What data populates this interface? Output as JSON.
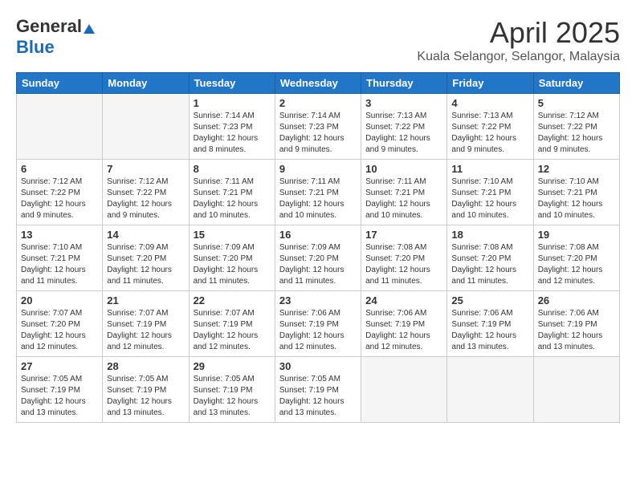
{
  "header": {
    "logo_general": "General",
    "logo_blue": "Blue",
    "title": "April 2025",
    "location": "Kuala Selangor, Selangor, Malaysia"
  },
  "weekdays": [
    "Sunday",
    "Monday",
    "Tuesday",
    "Wednesday",
    "Thursday",
    "Friday",
    "Saturday"
  ],
  "weeks": [
    [
      {
        "day": "",
        "sunrise": "",
        "sunset": "",
        "daylight": ""
      },
      {
        "day": "",
        "sunrise": "",
        "sunset": "",
        "daylight": ""
      },
      {
        "day": "1",
        "sunrise": "7:14 AM",
        "sunset": "7:23 PM",
        "daylight": "12 hours and 8 minutes."
      },
      {
        "day": "2",
        "sunrise": "7:14 AM",
        "sunset": "7:23 PM",
        "daylight": "12 hours and 9 minutes."
      },
      {
        "day": "3",
        "sunrise": "7:13 AM",
        "sunset": "7:22 PM",
        "daylight": "12 hours and 9 minutes."
      },
      {
        "day": "4",
        "sunrise": "7:13 AM",
        "sunset": "7:22 PM",
        "daylight": "12 hours and 9 minutes."
      },
      {
        "day": "5",
        "sunrise": "7:12 AM",
        "sunset": "7:22 PM",
        "daylight": "12 hours and 9 minutes."
      }
    ],
    [
      {
        "day": "6",
        "sunrise": "7:12 AM",
        "sunset": "7:22 PM",
        "daylight": "12 hours and 9 minutes."
      },
      {
        "day": "7",
        "sunrise": "7:12 AM",
        "sunset": "7:22 PM",
        "daylight": "12 hours and 9 minutes."
      },
      {
        "day": "8",
        "sunrise": "7:11 AM",
        "sunset": "7:21 PM",
        "daylight": "12 hours and 10 minutes."
      },
      {
        "day": "9",
        "sunrise": "7:11 AM",
        "sunset": "7:21 PM",
        "daylight": "12 hours and 10 minutes."
      },
      {
        "day": "10",
        "sunrise": "7:11 AM",
        "sunset": "7:21 PM",
        "daylight": "12 hours and 10 minutes."
      },
      {
        "day": "11",
        "sunrise": "7:10 AM",
        "sunset": "7:21 PM",
        "daylight": "12 hours and 10 minutes."
      },
      {
        "day": "12",
        "sunrise": "7:10 AM",
        "sunset": "7:21 PM",
        "daylight": "12 hours and 10 minutes."
      }
    ],
    [
      {
        "day": "13",
        "sunrise": "7:10 AM",
        "sunset": "7:21 PM",
        "daylight": "12 hours and 11 minutes."
      },
      {
        "day": "14",
        "sunrise": "7:09 AM",
        "sunset": "7:20 PM",
        "daylight": "12 hours and 11 minutes."
      },
      {
        "day": "15",
        "sunrise": "7:09 AM",
        "sunset": "7:20 PM",
        "daylight": "12 hours and 11 minutes."
      },
      {
        "day": "16",
        "sunrise": "7:09 AM",
        "sunset": "7:20 PM",
        "daylight": "12 hours and 11 minutes."
      },
      {
        "day": "17",
        "sunrise": "7:08 AM",
        "sunset": "7:20 PM",
        "daylight": "12 hours and 11 minutes."
      },
      {
        "day": "18",
        "sunrise": "7:08 AM",
        "sunset": "7:20 PM",
        "daylight": "12 hours and 11 minutes."
      },
      {
        "day": "19",
        "sunrise": "7:08 AM",
        "sunset": "7:20 PM",
        "daylight": "12 hours and 12 minutes."
      }
    ],
    [
      {
        "day": "20",
        "sunrise": "7:07 AM",
        "sunset": "7:20 PM",
        "daylight": "12 hours and 12 minutes."
      },
      {
        "day": "21",
        "sunrise": "7:07 AM",
        "sunset": "7:19 PM",
        "daylight": "12 hours and 12 minutes."
      },
      {
        "day": "22",
        "sunrise": "7:07 AM",
        "sunset": "7:19 PM",
        "daylight": "12 hours and 12 minutes."
      },
      {
        "day": "23",
        "sunrise": "7:06 AM",
        "sunset": "7:19 PM",
        "daylight": "12 hours and 12 minutes."
      },
      {
        "day": "24",
        "sunrise": "7:06 AM",
        "sunset": "7:19 PM",
        "daylight": "12 hours and 12 minutes."
      },
      {
        "day": "25",
        "sunrise": "7:06 AM",
        "sunset": "7:19 PM",
        "daylight": "12 hours and 13 minutes."
      },
      {
        "day": "26",
        "sunrise": "7:06 AM",
        "sunset": "7:19 PM",
        "daylight": "12 hours and 13 minutes."
      }
    ],
    [
      {
        "day": "27",
        "sunrise": "7:05 AM",
        "sunset": "7:19 PM",
        "daylight": "12 hours and 13 minutes."
      },
      {
        "day": "28",
        "sunrise": "7:05 AM",
        "sunset": "7:19 PM",
        "daylight": "12 hours and 13 minutes."
      },
      {
        "day": "29",
        "sunrise": "7:05 AM",
        "sunset": "7:19 PM",
        "daylight": "12 hours and 13 minutes."
      },
      {
        "day": "30",
        "sunrise": "7:05 AM",
        "sunset": "7:19 PM",
        "daylight": "12 hours and 13 minutes."
      },
      {
        "day": "",
        "sunrise": "",
        "sunset": "",
        "daylight": ""
      },
      {
        "day": "",
        "sunrise": "",
        "sunset": "",
        "daylight": ""
      },
      {
        "day": "",
        "sunrise": "",
        "sunset": "",
        "daylight": ""
      }
    ]
  ],
  "labels": {
    "sunrise": "Sunrise:",
    "sunset": "Sunset:",
    "daylight": "Daylight:"
  }
}
